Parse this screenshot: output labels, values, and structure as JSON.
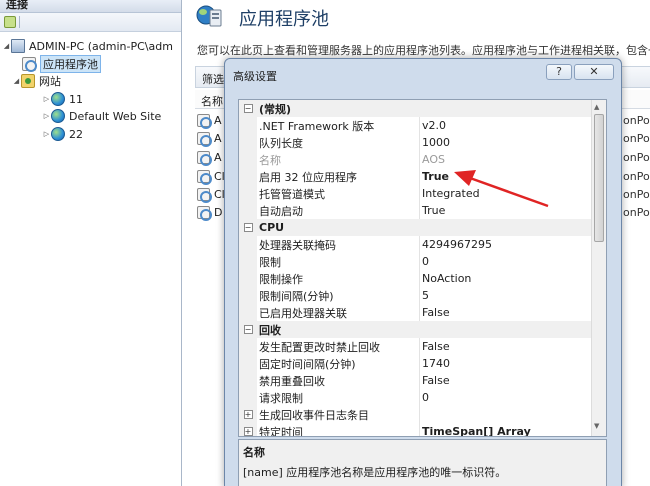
{
  "connections": {
    "header": "连接",
    "tree": {
      "server": "ADMIN-PC (admin-PC\\adm",
      "app_pools": "应用程序池",
      "sites": "网站",
      "site_items": [
        "11",
        "Default Web Site",
        "22"
      ]
    }
  },
  "main": {
    "title": "应用程序池",
    "description": "您可以在此页上查看和管理服务器上的应用程序池列表。应用程序池与工作进程相关联，包含一个",
    "filter_label": "筛选",
    "column_name": "名称",
    "pool_row_prefixes": [
      "A",
      "A",
      "A",
      "Cl",
      "Cl",
      "D"
    ],
    "pool_row_suffix": "onPoo"
  },
  "dialog": {
    "title": "高级设置",
    "help_label": "?",
    "close_label": "✕",
    "categories": {
      "general": "(常规)",
      "cpu": "CPU",
      "recycle": "回收"
    },
    "properties": {
      "netfx": {
        "name": ".NET Framework 版本",
        "value": "v2.0"
      },
      "queue": {
        "name": "队列长度",
        "value": "1000"
      },
      "pool_name": {
        "name": "名称",
        "value": "AOS"
      },
      "enable32": {
        "name": "启用 32 位应用程序",
        "value": "True"
      },
      "pipeline": {
        "name": "托管管道模式",
        "value": "Integrated"
      },
      "autostart": {
        "name": "自动启动",
        "value": "True"
      },
      "affinity_mask": {
        "name": "处理器关联掩码",
        "value": "4294967295"
      },
      "limit": {
        "name": "限制",
        "value": "0"
      },
      "limit_action": {
        "name": "限制操作",
        "value": "NoAction"
      },
      "limit_interval": {
        "name": "限制间隔(分钟)",
        "value": "5"
      },
      "affinity_enabled": {
        "name": "已启用处理器关联",
        "value": "False"
      },
      "disallow_rotation": {
        "name": "发生配置更改时禁止回收",
        "value": "False"
      },
      "fixed_interval": {
        "name": "固定时间间隔(分钟)",
        "value": "1740"
      },
      "disallow_overlap": {
        "name": "禁用重叠回收",
        "value": "False"
      },
      "request_limit": {
        "name": "请求限制",
        "value": "0"
      },
      "log_events": {
        "name": "生成回收事件日志条目",
        "value": ""
      },
      "specific_times": {
        "name": "特定时间",
        "value": "TimeSpan[] Array"
      }
    },
    "description": {
      "name": "名称",
      "text": "[name] 应用程序池名称是应用程序池的唯一标识符。"
    }
  },
  "colors": {
    "annotation_arrow": "#e02424",
    "dialog_chrome": "#cfdcec",
    "selection": "#cce4f7"
  }
}
